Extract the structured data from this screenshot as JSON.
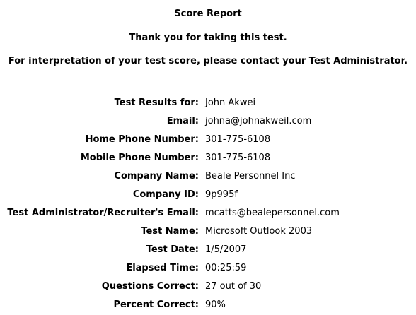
{
  "header": {
    "title": "Score Report",
    "thank_you": "Thank you for taking this test.",
    "interpretation": "For interpretation of your test score, please contact your Test Administrator."
  },
  "results": [
    {
      "label": "Test Results for:",
      "value": "John Akwei"
    },
    {
      "label": "Email:",
      "value": "johna@johnakweil.com"
    },
    {
      "label": "Home Phone Number:",
      "value": "301-775-6108"
    },
    {
      "label": "Mobile Phone Number:",
      "value": "301-775-6108"
    },
    {
      "label": "Company Name:",
      "value": "Beale Personnel Inc"
    },
    {
      "label": "Company ID:",
      "value": "9p995f"
    },
    {
      "label": "Test Administrator/Recruiter's Email:",
      "value": "mcatts@bealepersonnel.com"
    },
    {
      "label": "Test Name:",
      "value": "Microsoft Outlook 2003"
    },
    {
      "label": "Test Date:",
      "value": "1/5/2007"
    },
    {
      "label": "Elapsed Time:",
      "value": "00:25:59"
    },
    {
      "label": "Questions Correct:",
      "value": "27 out of 30"
    },
    {
      "label": "Percent Correct:",
      "value": "90%"
    }
  ]
}
